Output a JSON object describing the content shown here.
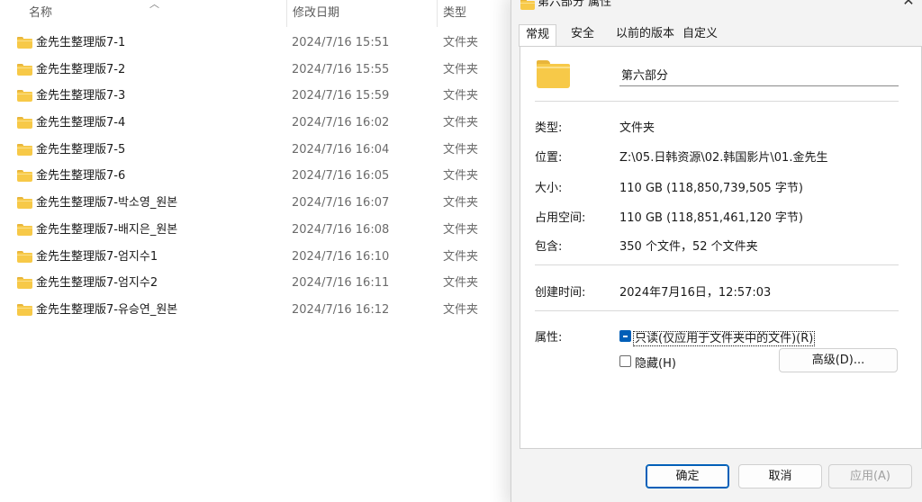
{
  "explorer": {
    "columns": {
      "name": "名称",
      "date": "修改日期",
      "type": "类型"
    },
    "rows": [
      {
        "name": "金先生整理版7-1",
        "date": "2024/7/16 15:51",
        "type": "文件夹"
      },
      {
        "name": "金先生整理版7-2",
        "date": "2024/7/16 15:55",
        "type": "文件夹"
      },
      {
        "name": "金先生整理版7-3",
        "date": "2024/7/16 15:59",
        "type": "文件夹"
      },
      {
        "name": "金先生整理版7-4",
        "date": "2024/7/16 16:02",
        "type": "文件夹"
      },
      {
        "name": "金先生整理版7-5",
        "date": "2024/7/16 16:04",
        "type": "文件夹"
      },
      {
        "name": "金先生整理版7-6",
        "date": "2024/7/16 16:05",
        "type": "文件夹"
      },
      {
        "name": "金先生整理版7-박소영_원본",
        "date": "2024/7/16 16:07",
        "type": "文件夹"
      },
      {
        "name": "金先生整理版7-배지은_원본",
        "date": "2024/7/16 16:08",
        "type": "文件夹"
      },
      {
        "name": "金先生整理版7-엄지수1",
        "date": "2024/7/16 16:10",
        "type": "文件夹"
      },
      {
        "name": "金先生整理版7-엄지수2",
        "date": "2024/7/16 16:11",
        "type": "文件夹"
      },
      {
        "name": "金先生整理版7-유승연_원본",
        "date": "2024/7/16 16:12",
        "type": "文件夹"
      }
    ]
  },
  "dialog": {
    "title": "第六部分 属性",
    "close_icon": "close-icon",
    "tabs": [
      "常规",
      "安全",
      "以前的版本",
      "自定义"
    ],
    "active_tab": "常规",
    "folder_name": "第六部分",
    "props": {
      "type_label": "类型:",
      "type_value": "文件夹",
      "location_label": "位置:",
      "location_value": "Z:\\05.日韩资源\\02.韩国影片\\01.金先生",
      "size_label": "大小:",
      "size_value": "110 GB (118,850,739,505 字节)",
      "disk_label": "占用空间:",
      "disk_value": "110 GB (118,851,461,120 字节)",
      "contains_label": "包含:",
      "contains_value": "350 个文件，52 个文件夹",
      "created_label": "创建时间:",
      "created_value": "2024年7月16日，12:57:03",
      "attributes_label": "属性:",
      "readonly_label": "只读(仅应用于文件夹中的文件)(R)",
      "hidden_label": "隐藏(H)",
      "advanced_label": "高级(D)..."
    },
    "buttons": {
      "ok": "确定",
      "cancel": "取消",
      "apply": "应用(A)"
    }
  },
  "colors": {
    "accent": "#005fb8",
    "folder": "#f7c948"
  }
}
